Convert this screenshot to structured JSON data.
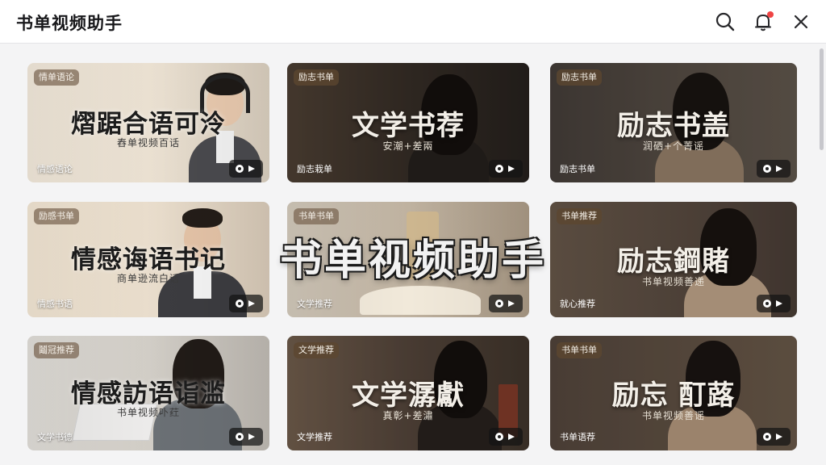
{
  "app": {
    "title": "书单视频助手"
  },
  "header": {
    "icons": [
      "search-icon",
      "bell-icon",
      "close-icon"
    ],
    "notification_dot_color": "#ef4444"
  },
  "overlay": {
    "watermark_text": "书单视频助手"
  },
  "cards": [
    {
      "tag": "情单语论",
      "title": "熠踞合语可泠",
      "subtitle": "舂单视频百话",
      "bottom_label": "情感语论",
      "theme": "light"
    },
    {
      "tag": "励志书单",
      "title": "文学书荐",
      "subtitle": "安潮+差兩",
      "bottom_label": "励志栽单",
      "theme": "dark"
    },
    {
      "tag": "励志书单",
      "title": "励志书盖",
      "subtitle": "润硒+个菁谣",
      "bottom_label": "励志书单",
      "theme": "dark"
    },
    {
      "tag": "励感书单",
      "title": "情感诲语书记",
      "subtitle": "商单逊流白话",
      "bottom_label": "情感书语",
      "theme": "light"
    },
    {
      "tag": "书单书单",
      "title": "",
      "subtitle": "",
      "bottom_label": "文学推荐",
      "theme": "light"
    },
    {
      "tag": "书单推荐",
      "title": "励志鋼賭",
      "subtitle": "书单视频善递",
      "bottom_label": "就心推荐",
      "theme": "dark"
    },
    {
      "tag": "鬮冠推荐",
      "title": "情感訪语诣滥",
      "subtitle": "书单视频卟荭",
      "bottom_label": "文学书德",
      "theme": "light"
    },
    {
      "tag": "文学推荐",
      "title": "文学潺獻",
      "subtitle": "真彰+差潚",
      "bottom_label": "文学推荐",
      "theme": "dark"
    },
    {
      "tag": "书单书单",
      "title": "励忘 酊蕗",
      "subtitle": "书单视频善谣",
      "bottom_label": "书单语荐",
      "theme": "dark"
    }
  ]
}
